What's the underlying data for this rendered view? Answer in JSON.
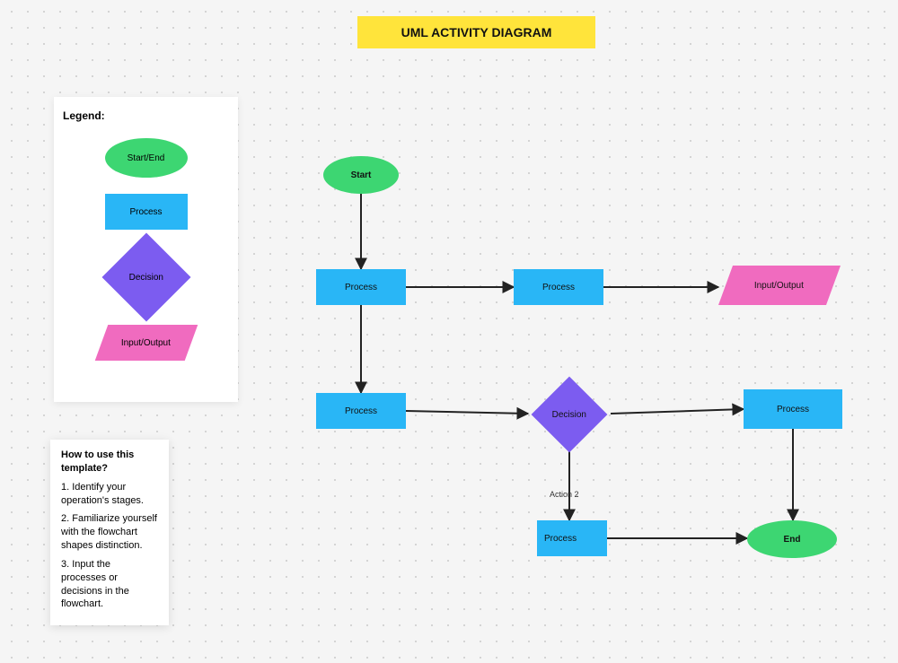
{
  "title": "UML ACTIVITY DIAGRAM",
  "legend": {
    "heading": "Legend:",
    "startend": "Start/End",
    "process": "Process",
    "decision": "Decision",
    "io": "Input/Output"
  },
  "howto": {
    "heading": "How to use this template?",
    "s1": "1. Identify your operation's stages.",
    "s2": "2. Familiarize yourself with the flowchart shapes distinction.",
    "s3": "3. Input the processes or decisions in the flowchart."
  },
  "nodes": {
    "start": "Start",
    "p1": "Process",
    "p2": "Process",
    "io1": "Input/Output",
    "p3": "Process",
    "decision": "Decision",
    "p4": "Process",
    "p5": "Process",
    "end": "End"
  },
  "labels": {
    "action2": "Action 2"
  },
  "chart_data": {
    "type": "flowchart",
    "title": "UML ACTIVITY DIAGRAM",
    "nodes": [
      {
        "id": "start",
        "kind": "terminator",
        "label": "Start"
      },
      {
        "id": "p1",
        "kind": "process",
        "label": "Process"
      },
      {
        "id": "p2",
        "kind": "process",
        "label": "Process"
      },
      {
        "id": "io1",
        "kind": "io",
        "label": "Input/Output"
      },
      {
        "id": "p3",
        "kind": "process",
        "label": "Process"
      },
      {
        "id": "decision",
        "kind": "decision",
        "label": "Decision"
      },
      {
        "id": "p4",
        "kind": "process",
        "label": "Process"
      },
      {
        "id": "p5",
        "kind": "process",
        "label": "Process"
      },
      {
        "id": "end",
        "kind": "terminator",
        "label": "End"
      }
    ],
    "edges": [
      {
        "from": "start",
        "to": "p1"
      },
      {
        "from": "p1",
        "to": "p2"
      },
      {
        "from": "p2",
        "to": "io1"
      },
      {
        "from": "p1",
        "to": "p3"
      },
      {
        "from": "p3",
        "to": "decision"
      },
      {
        "from": "decision",
        "to": "p4"
      },
      {
        "from": "decision",
        "to": "p5",
        "label": "Action 2"
      },
      {
        "from": "p4",
        "to": "end"
      },
      {
        "from": "p5",
        "to": "end"
      }
    ],
    "legend": [
      {
        "shape": "ellipse",
        "label": "Start/End",
        "color": "#3dd672"
      },
      {
        "shape": "rectangle",
        "label": "Process",
        "color": "#29b6f6"
      },
      {
        "shape": "diamond",
        "label": "Decision",
        "color": "#7c5cf0"
      },
      {
        "shape": "parallelogram",
        "label": "Input/Output",
        "color": "#f06bbf"
      }
    ]
  }
}
